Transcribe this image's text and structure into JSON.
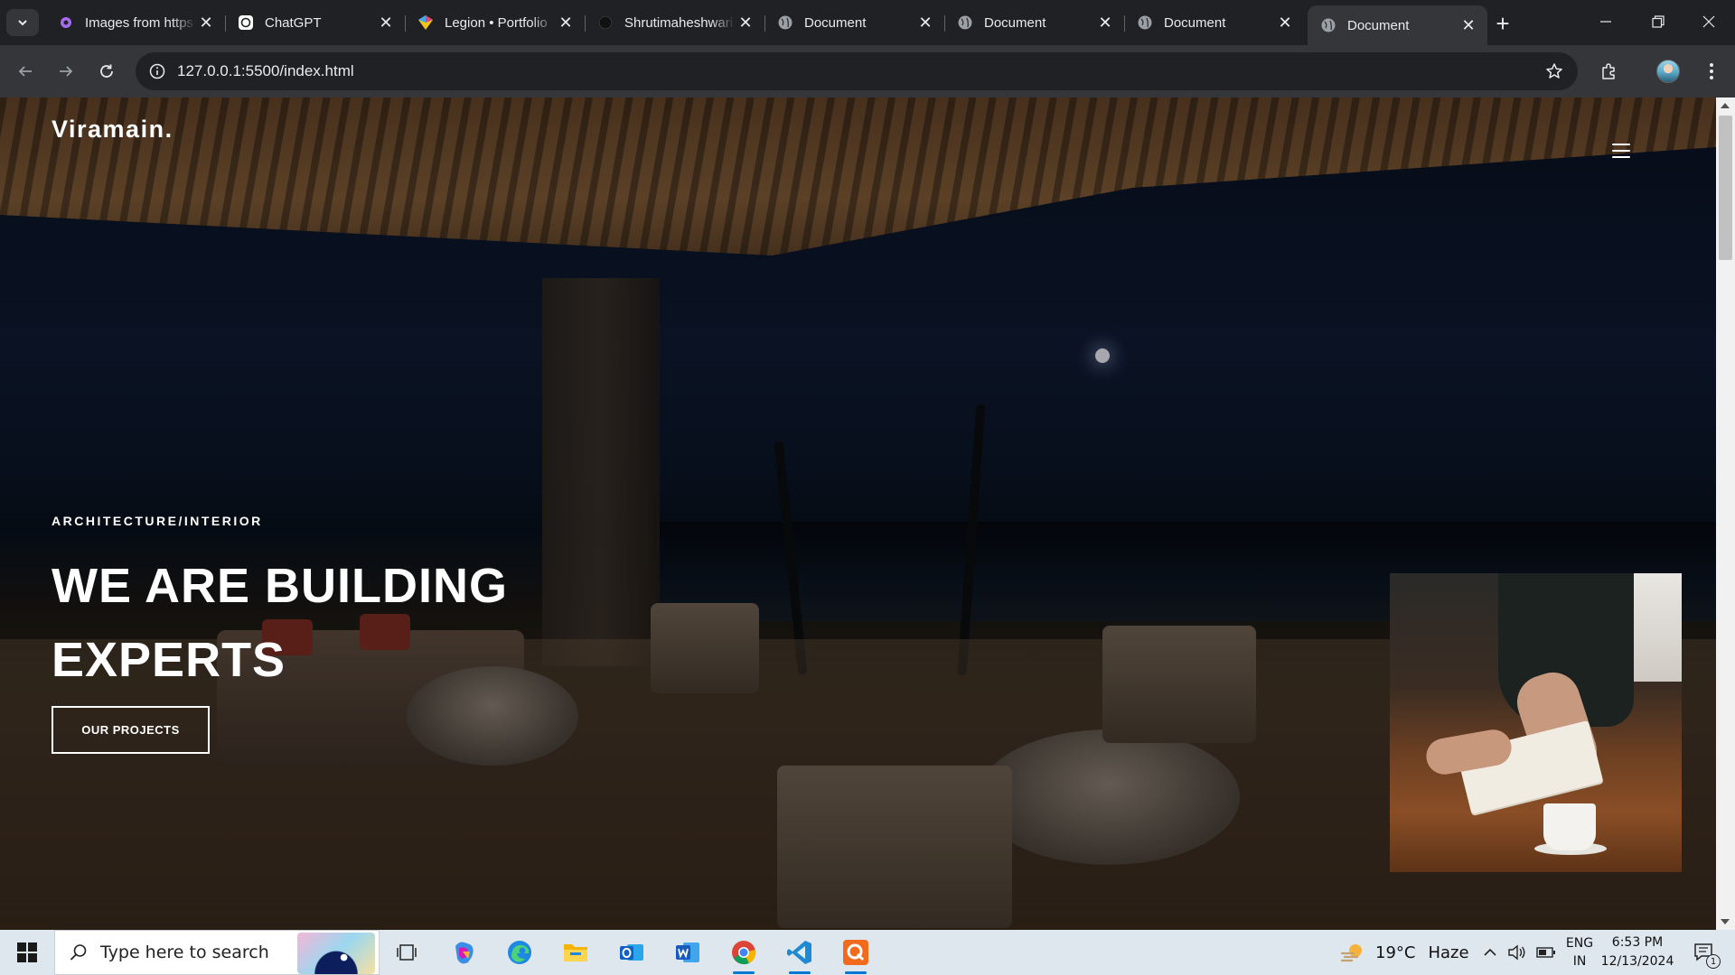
{
  "browser": {
    "tabs": [
      {
        "title": "Images from https",
        "icon": "settings-favicon-icon",
        "active": false
      },
      {
        "title": "ChatGPT",
        "icon": "openai-favicon-icon",
        "active": false
      },
      {
        "title": "Legion • Portfolio",
        "icon": "legion-favicon-icon",
        "active": false
      },
      {
        "title": "Shrutimaheshwari",
        "icon": "github-favicon-icon",
        "active": false
      },
      {
        "title": "Document",
        "icon": "globe-favicon-icon",
        "active": false
      },
      {
        "title": "Document",
        "icon": "globe-favicon-icon",
        "active": false
      },
      {
        "title": "Document",
        "icon": "globe-favicon-icon",
        "active": false
      },
      {
        "title": "Document",
        "icon": "globe-favicon-icon",
        "active": true
      }
    ],
    "close_glyph": "✕",
    "new_tab_glyph": "+",
    "url": "127.0.0.1:5500/index.html"
  },
  "page": {
    "brand": "Viramain.",
    "kicker": "ARCHITECTURE/INTERIOR",
    "headline_line1": "WE ARE BUILDING",
    "headline_line2": "EXPERTS",
    "cta_label": "OUR PROJECTS"
  },
  "taskbar": {
    "search_placeholder": "Type here to search",
    "pinned_apps": [
      "task-view-icon",
      "copilot-icon",
      "edge-icon",
      "file-explorer-icon",
      "outlook-icon",
      "word-icon",
      "chrome-icon",
      "vscode-icon",
      "q-app-icon"
    ],
    "weather": {
      "temp": "19°C",
      "condition": "Haze"
    },
    "language": {
      "lang": "ENG",
      "region": "IN"
    },
    "clock": {
      "time": "6:53 PM",
      "date": "12/13/2024"
    },
    "notification_count": "1"
  },
  "colors": {
    "chrome_dark": "#202124",
    "chrome_toolbar": "#35363a",
    "taskbar_bg": "#dfe7ee",
    "accent_blue": "#0078d4"
  }
}
